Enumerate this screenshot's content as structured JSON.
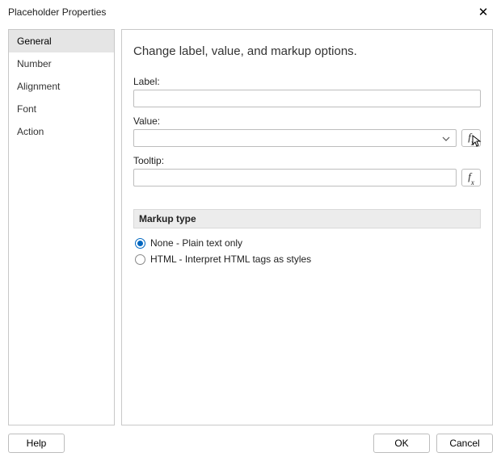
{
  "window": {
    "title": "Placeholder Properties"
  },
  "sidebar": {
    "items": [
      {
        "label": "General"
      },
      {
        "label": "Number"
      },
      {
        "label": "Alignment"
      },
      {
        "label": "Font"
      },
      {
        "label": "Action"
      }
    ]
  },
  "main": {
    "heading": "Change label, value, and markup options.",
    "label_field": {
      "label": "Label:",
      "value": ""
    },
    "value_field": {
      "label": "Value:",
      "value": ""
    },
    "tooltip_field": {
      "label": "Tooltip:",
      "value": ""
    },
    "fx_label": "fx",
    "markup": {
      "section": "Markup type",
      "options": [
        {
          "label": "None - Plain text only",
          "checked": true
        },
        {
          "label": "HTML - Interpret HTML tags as styles",
          "checked": false
        }
      ]
    }
  },
  "footer": {
    "help": "Help",
    "ok": "OK",
    "cancel": "Cancel"
  }
}
